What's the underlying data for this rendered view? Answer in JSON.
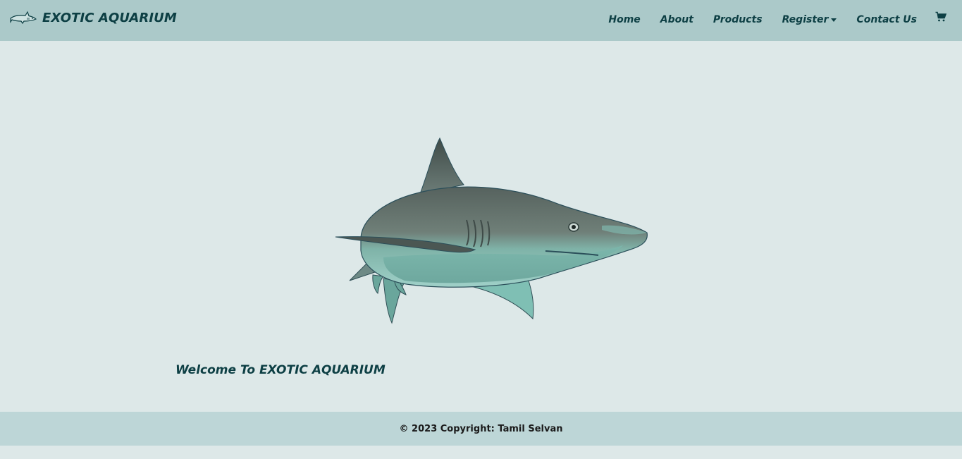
{
  "brand": {
    "name": "EXOTIC AQUARIUM",
    "logo_icon": "shark-logo-icon"
  },
  "nav": {
    "items": [
      {
        "label": "Home"
      },
      {
        "label": "About"
      },
      {
        "label": "Products"
      },
      {
        "label": "Register",
        "dropdown": true
      },
      {
        "label": "Contact Us"
      }
    ],
    "cart_icon": "cart-icon"
  },
  "hero": {
    "image": "shark-image",
    "welcome": "Welcome To EXOTIC AQUARIUM"
  },
  "footer": {
    "copyright": "© 2023 Copyright: Tamil Selvan"
  },
  "colors": {
    "navbar_bg": "#abc9c9",
    "page_bg": "#dde8e8",
    "footer_bg": "#bdd6d7",
    "text_primary": "#0d3f44"
  }
}
